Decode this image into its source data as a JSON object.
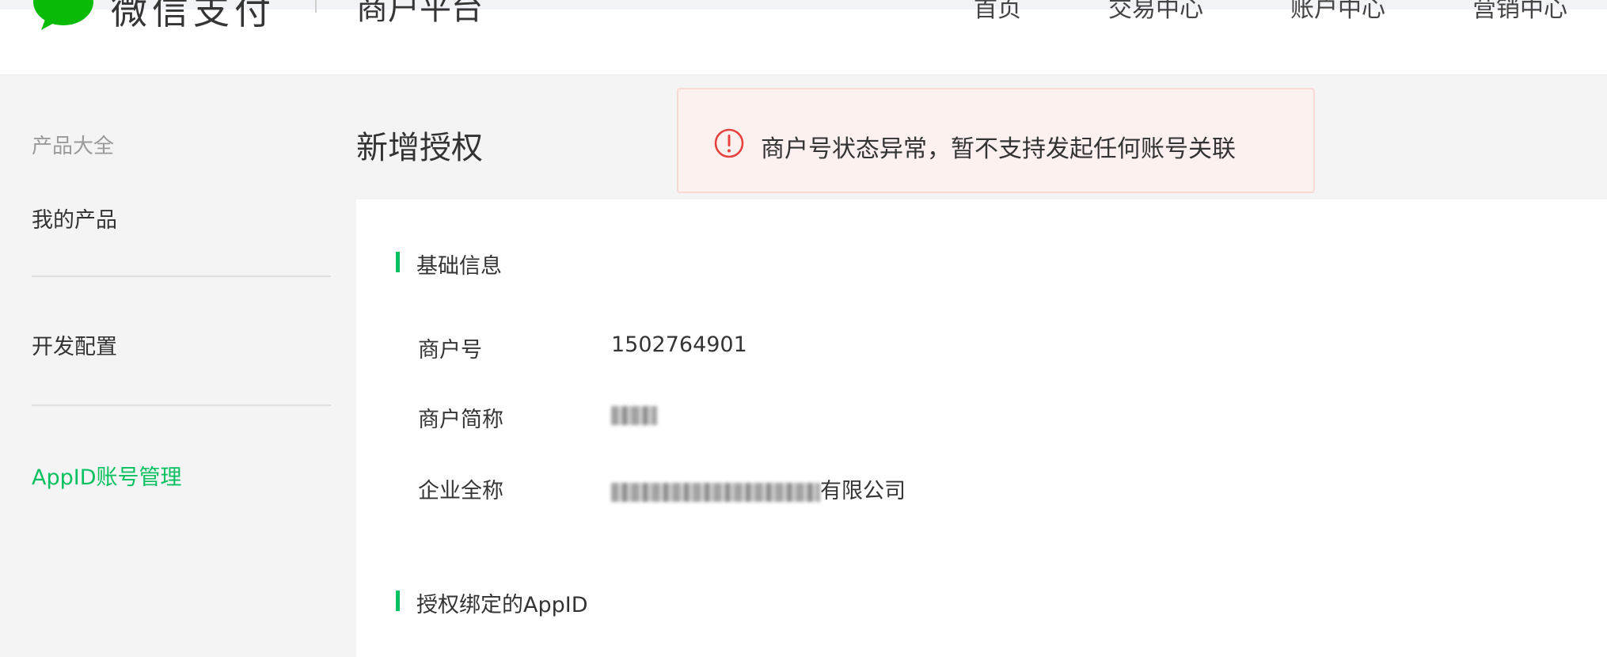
{
  "header": {
    "brand": "微信支付",
    "platform": "商户平台",
    "nav": [
      "首页",
      "交易中心",
      "账户中心",
      "营销中心"
    ]
  },
  "sidebar": {
    "heading": "产品大全",
    "items": [
      {
        "label": "我的产品"
      },
      {
        "label": "开发配置"
      },
      {
        "label": "AppID账号管理",
        "active": true
      }
    ]
  },
  "page": {
    "title": "新增授权"
  },
  "alert": {
    "message": "商户号状态异常，暂不支持发起任何账号关联",
    "color": "#e64340"
  },
  "basic_info": {
    "section_title": "基础信息",
    "rows": [
      {
        "label": "商户号",
        "value": "1502764901"
      },
      {
        "label": "商户简称",
        "value": ""
      },
      {
        "label": "企业全称",
        "value_suffix": "有限公司"
      }
    ]
  },
  "bound_appid": {
    "section_title": "授权绑定的AppID"
  },
  "colors": {
    "accent": "#07c160",
    "alert_bg": "#fdf1ef"
  }
}
